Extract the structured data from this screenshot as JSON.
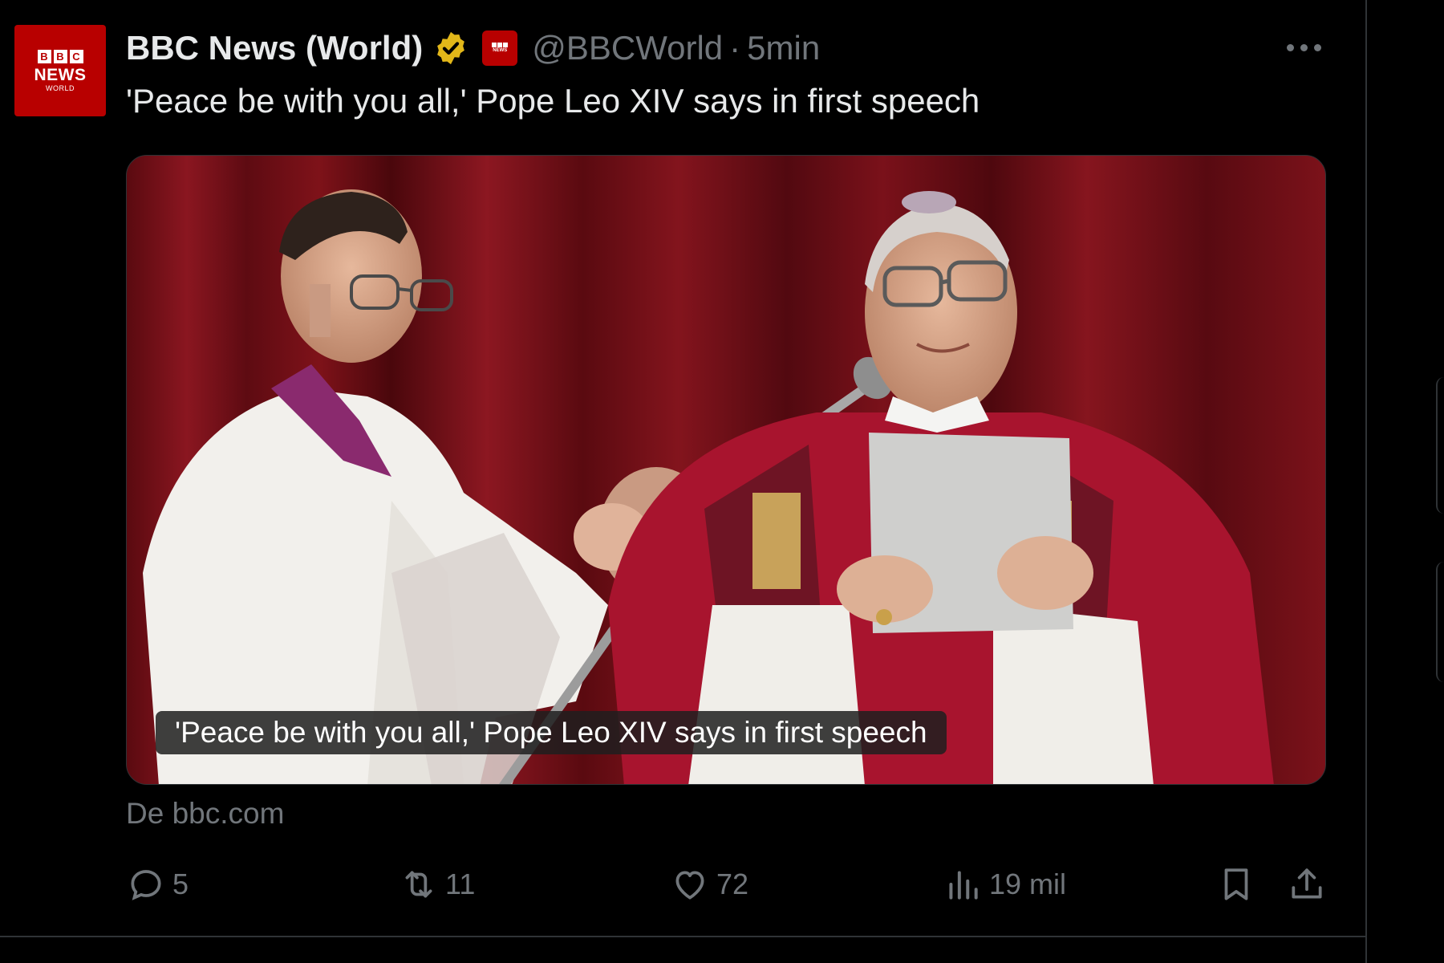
{
  "avatar": {
    "brand_blocks": [
      "B",
      "B",
      "C"
    ],
    "line1": "NEWS",
    "line2": "WORLD"
  },
  "author": {
    "name": "BBC News (World)",
    "handle": "@BBCWorld",
    "separator": "·",
    "time": "5min"
  },
  "tweet": {
    "text": "'Peace be with you all,' Pope Leo XIV says in first speech",
    "media_caption": "'Peace be with you all,' Pope Leo XIV says in first speech",
    "source": "De bbc.com"
  },
  "actions": {
    "reply_count": "5",
    "retweet_count": "11",
    "like_count": "72",
    "views_count": "19 mil"
  },
  "colors": {
    "background": "#000000",
    "text": "#e7e9ea",
    "muted": "#71767b",
    "brand_red": "#b80000",
    "verified_gold": "#e2b719"
  },
  "icons": [
    "more-icon",
    "verified-icon",
    "affiliate-badge-icon",
    "reply-icon",
    "retweet-icon",
    "like-icon",
    "views-icon",
    "bookmark-icon",
    "share-icon"
  ]
}
